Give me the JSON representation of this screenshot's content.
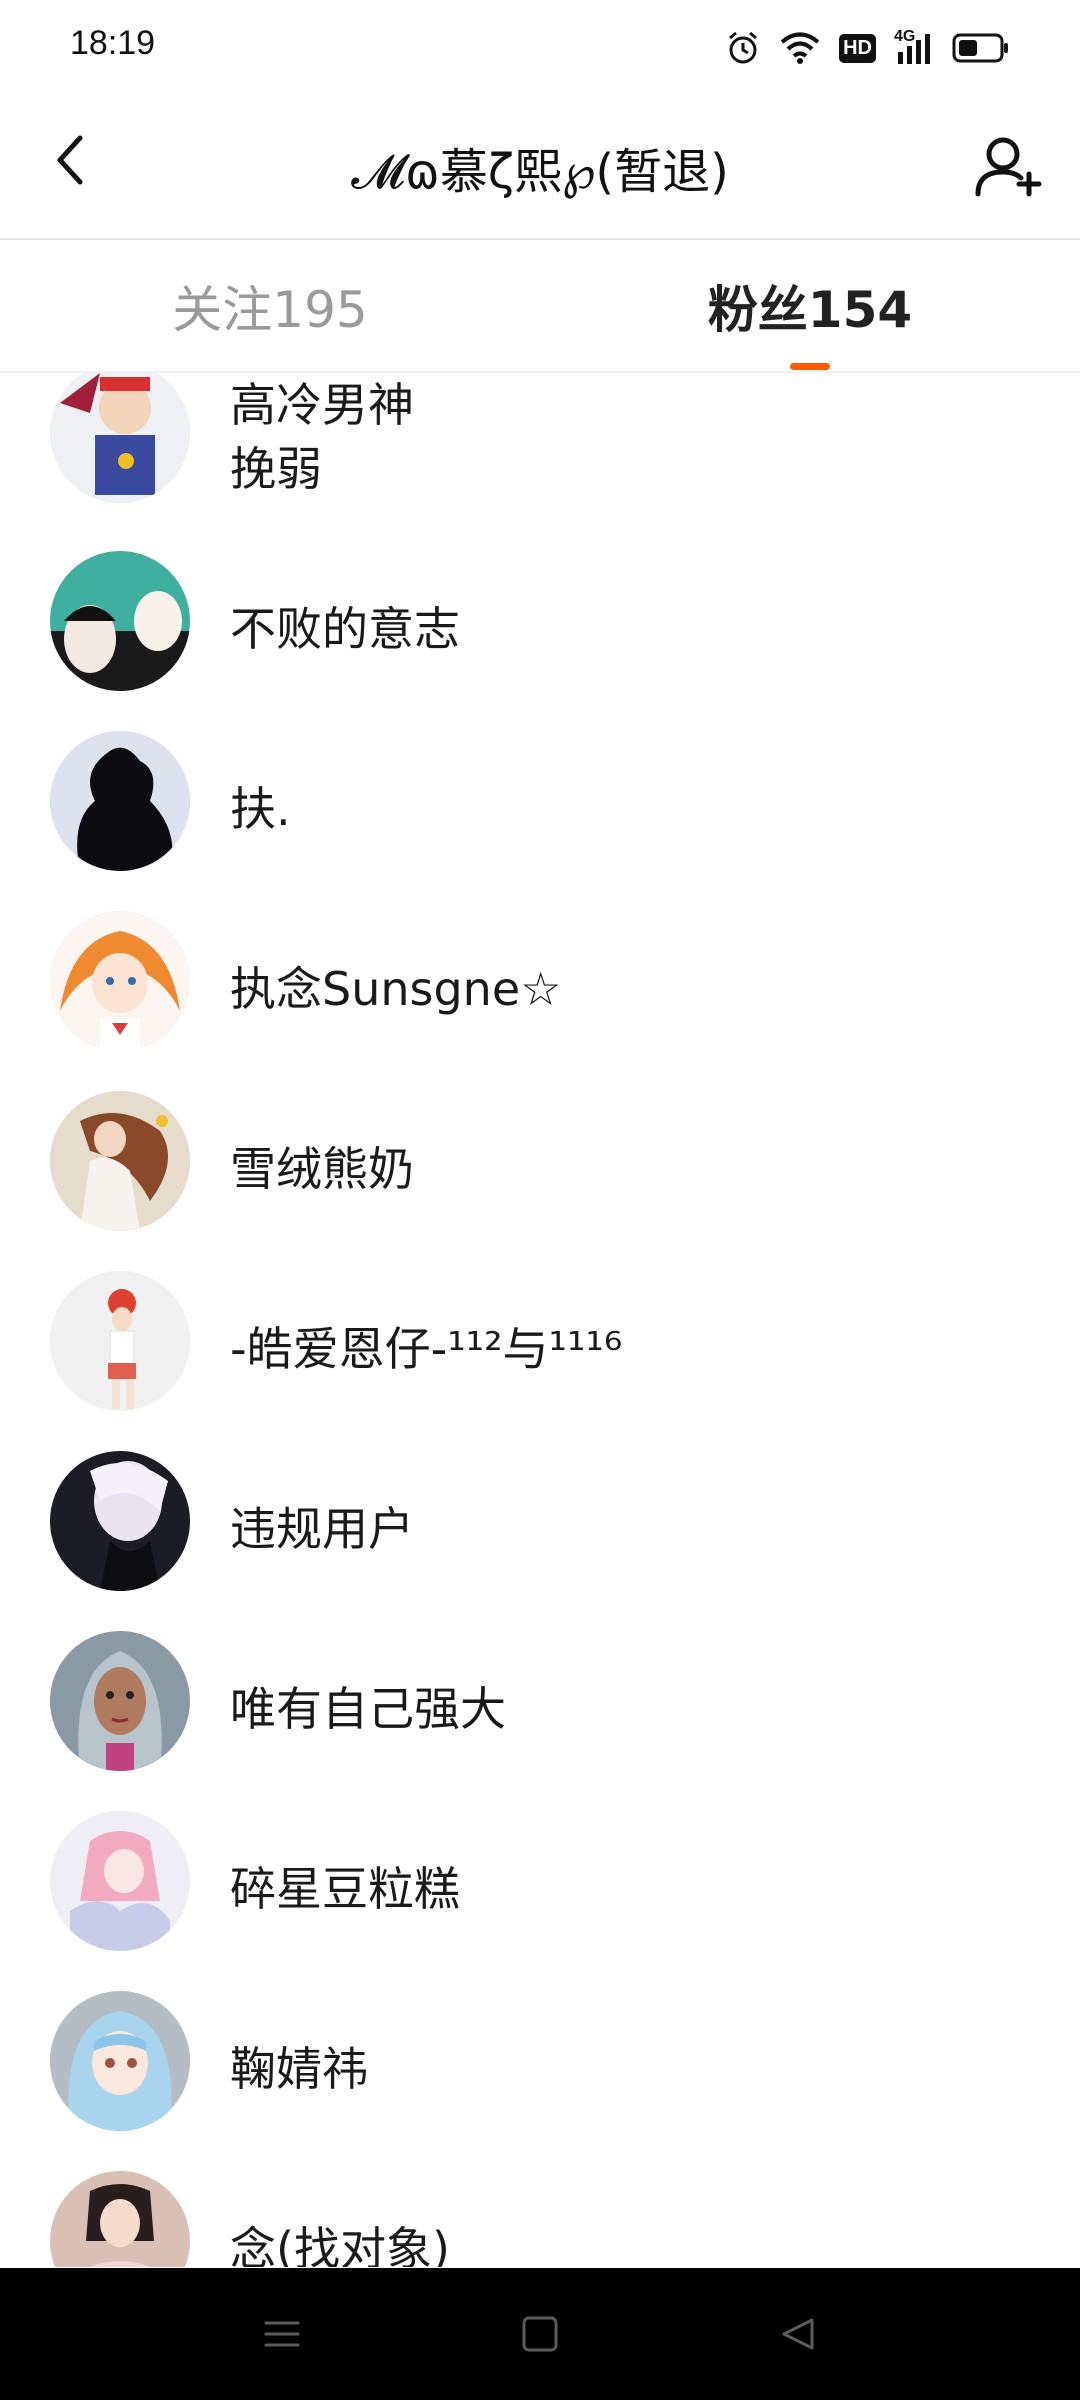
{
  "status_bar": {
    "time": "18:19",
    "icons": [
      "alarm-icon",
      "wifi-icon",
      "hd-icon",
      "signal-4g-icon",
      "battery-icon"
    ],
    "hd_label": "HD",
    "network_label": "4G"
  },
  "header": {
    "title": "𝓜ɷ慕ζ熙℘(暂退)",
    "back_icon": "chevron-left-icon",
    "add_user_icon": "add-user-icon"
  },
  "tabs": {
    "following_label": "关注195",
    "followers_label": "粉丝154",
    "active": "followers",
    "accent_color": "#ff5a00"
  },
  "followers": [
    {
      "name": "高冷男神\n挽弱"
    },
    {
      "name": "不败的意志"
    },
    {
      "name": "扶."
    },
    {
      "name": "执念Sunsgne☆"
    },
    {
      "name": "雪绒熊奶"
    },
    {
      "name": "-皓爱恩仔-¹¹²与¹¹¹⁶"
    },
    {
      "name": "违规用户"
    },
    {
      "name": "唯有自己强大"
    },
    {
      "name": "碎星豆粒糕"
    },
    {
      "name": "鞠婧祎"
    },
    {
      "name": "念(找对象)"
    }
  ],
  "nav_bar": {
    "icons": [
      "menu-icon",
      "home-square-icon",
      "back-triangle-icon"
    ]
  }
}
